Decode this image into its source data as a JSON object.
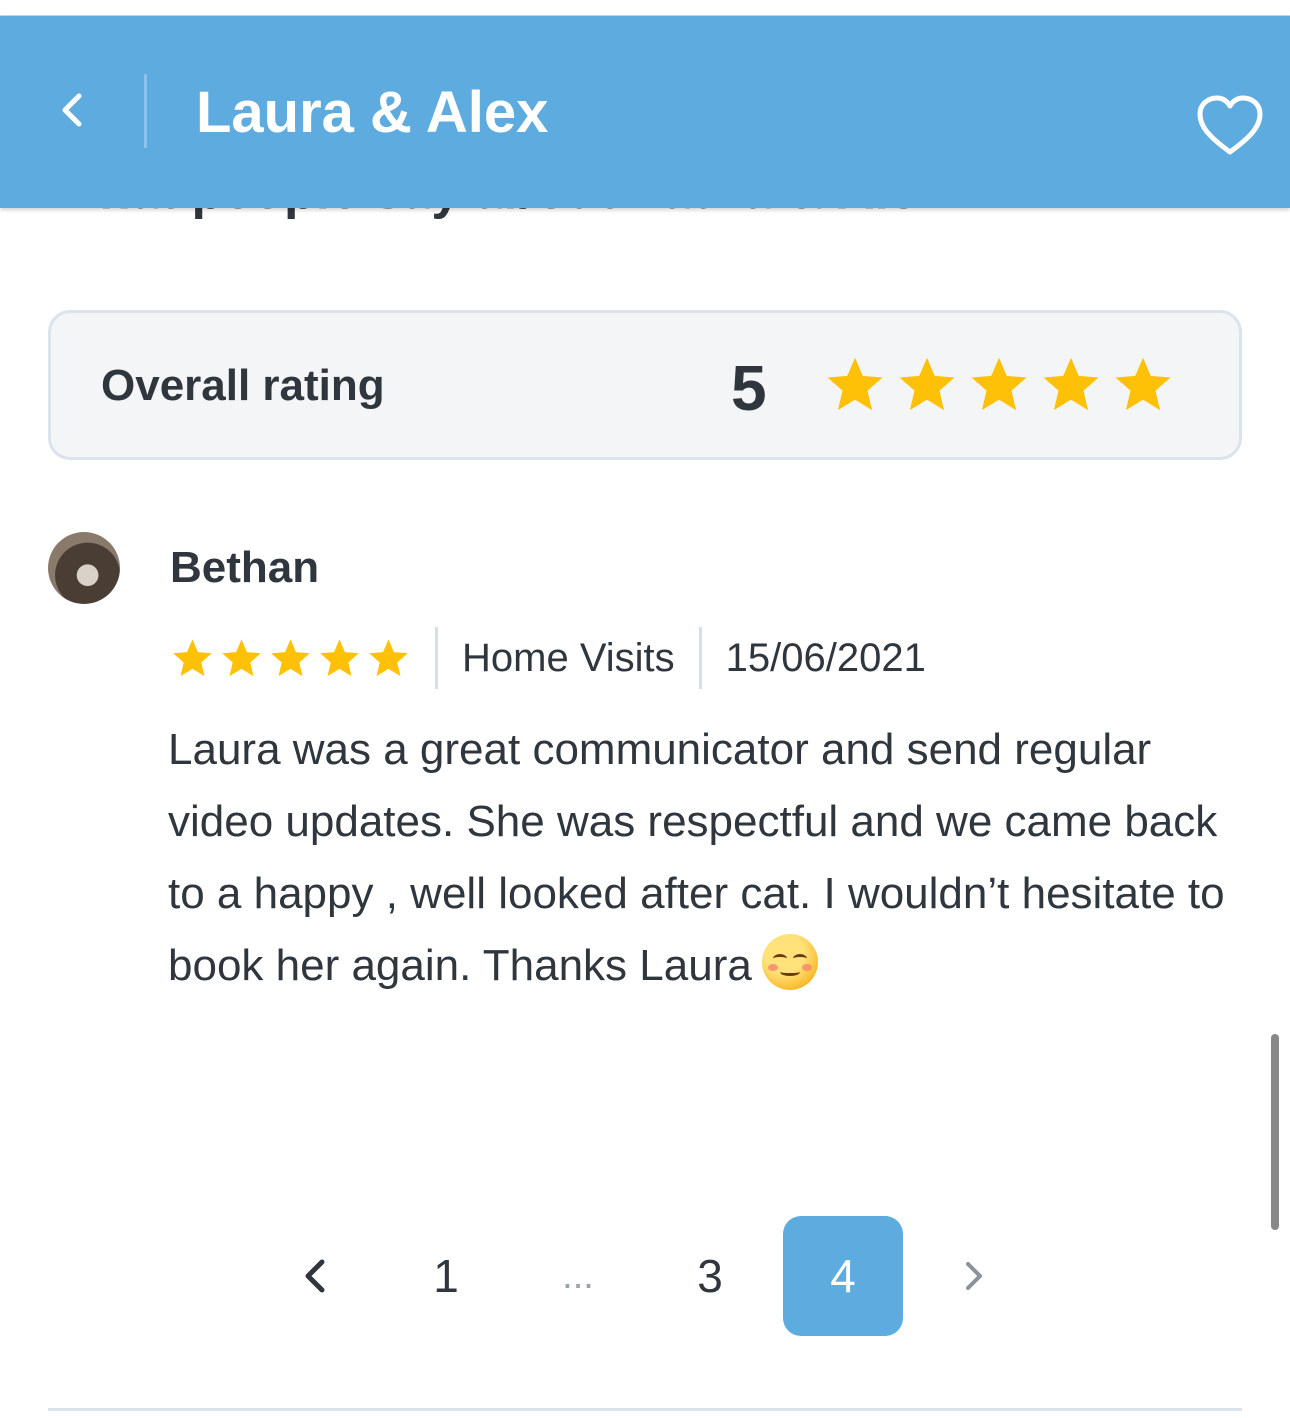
{
  "header": {
    "title": "Laura & Alex",
    "back_icon": "chevron-left-icon",
    "favorite_icon": "heart-outline-icon",
    "background_color": "#5eabe0"
  },
  "section": {
    "title": "What people say about Laura & Alex"
  },
  "overall_rating": {
    "label": "Overall rating",
    "value": "5",
    "stars": 5,
    "star_color": "#ffc107"
  },
  "reviews": [
    {
      "name": "Bethan",
      "stars": 5,
      "service": "Home Visits",
      "date": "15/06/2021",
      "text": "Laura was a great communicator and send regular video updates. She was respectful and we came back to a happy , well looked after cat. I wouldn’t  hesitate to book her again. Thanks Laura",
      "emoji": "smiling-face-icon"
    }
  ],
  "pagination": {
    "prev_icon": "chevron-left-icon",
    "next_icon": "chevron-right-icon",
    "pages": [
      "1",
      "...",
      "3",
      "4"
    ],
    "current": "4",
    "active_color": "#5eabe0"
  }
}
